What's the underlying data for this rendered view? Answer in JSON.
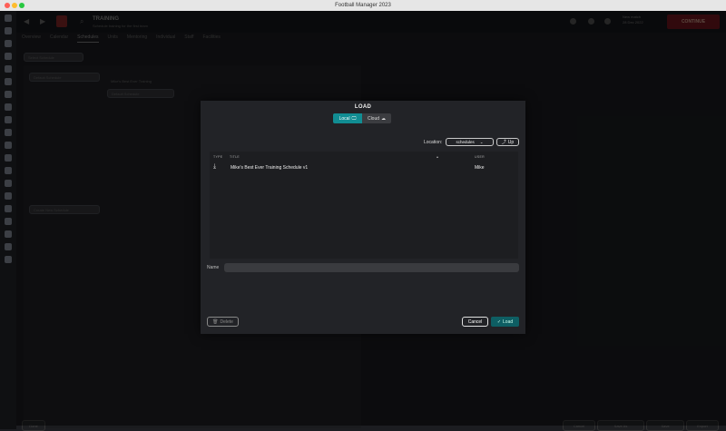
{
  "window": {
    "title": "Football Manager 2023"
  },
  "app": {
    "title": "TRAINING",
    "subtitle": "Schedule training for the first team",
    "date_line1": "New match",
    "date_line2": "28 Dec 2022",
    "continue_label": "CONTINUE",
    "tabs": [
      "Overview",
      "Calendar",
      "Schedules",
      "Units",
      "Mentoring",
      "Individual",
      "Staff",
      "Facilities"
    ],
    "schedule_dropdown": "Select Schedule",
    "add_schedule": "Create New Schedule",
    "schedule_item": "Mike's Best Ever Training",
    "schedule_name": "Default Schedule",
    "footer_buttons": [
      "Done",
      "Cancel",
      "Save As",
      "Save",
      "Export"
    ]
  },
  "dialog": {
    "title": "LOAD",
    "segments": {
      "local": "Local",
      "cloud": "Cloud"
    },
    "location_label": "Location:",
    "location_value": "schedules",
    "up_label": "Up",
    "columns": {
      "type": "TYPE",
      "title": "TITLE",
      "user": "USER"
    },
    "rows": [
      {
        "title": "Mike's Best Ever Training Schedule v1",
        "user": "Mike",
        "icon": "download-icon"
      }
    ],
    "name_label": "Name",
    "name_value": "",
    "delete_label": "Delete",
    "cancel_label": "Cancel",
    "load_label": "Load"
  },
  "colors": {
    "accent": "#118d93",
    "load_button": "#0e5e63",
    "continue": "#5a1219"
  }
}
